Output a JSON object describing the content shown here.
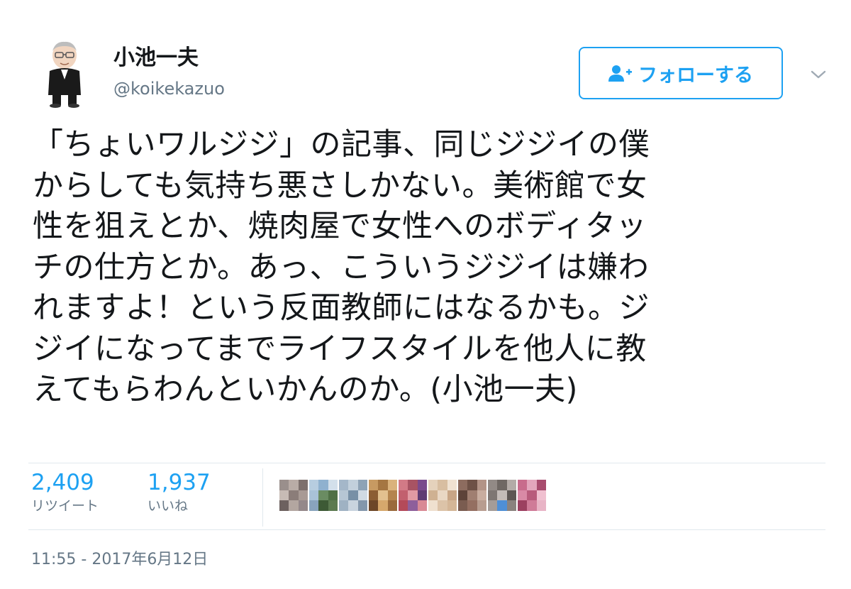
{
  "profile": {
    "display_name": "小池一夫",
    "username": "@koikekazuo"
  },
  "follow_button": {
    "label": "フォローする"
  },
  "tweet": {
    "lines": [
      "「ちょいワルジジ」の記事、同じジジイの僕",
      "からしても気持ち悪さしかない。美術館で女",
      "性を狙えとか、焼肉屋で女性へのボディタッ",
      "チの仕方とか。あっ、こういうジジイは嫌わ",
      "れますよ！という反面教師にはなるかも。ジ",
      "ジイになってまでライフスタイルを他人に教",
      "えてもらわんといかんのか。(小池一夫)"
    ]
  },
  "stats": {
    "retweets": {
      "count": "2,409",
      "label": "リツイート"
    },
    "likes": {
      "count": "1,937",
      "label": "いいね"
    }
  },
  "likers": [
    [
      "#9a8f8c",
      "#b9aca6",
      "#7d706d",
      "#c7bbb5",
      "#8b7d79",
      "#a89a95",
      "#6d615f",
      "#b3a6a0",
      "#94888a"
    ],
    [
      "#b7cde0",
      "#8fb1cf",
      "#d3e0eb",
      "#a9c2d8",
      "#6a8c62",
      "#4f7045",
      "#89a4bd",
      "#3d5a35",
      "#5c7a50"
    ],
    [
      "#a4b7c9",
      "#c2d0dc",
      "#8ea3b6",
      "#b6c6d4",
      "#7890a6",
      "#d0dae3",
      "#9fb2c3",
      "#c9d4de",
      "#8397ab"
    ],
    [
      "#c79a62",
      "#a57642",
      "#dab27c",
      "#8c5e34",
      "#e2c08f",
      "#b4844e",
      "#6d4728",
      "#d6a86c",
      "#9a6a3c"
    ],
    [
      "#d27a86",
      "#a85363",
      "#7a4a8c",
      "#c2606e",
      "#e09aa3",
      "#5f3c73",
      "#b44a5a",
      "#8e5f9b",
      "#d98a95"
    ],
    [
      "#e5d2bc",
      "#d8bea1",
      "#f0e2d2",
      "#cfb192",
      "#e9d7c4",
      "#c8a586",
      "#efe0cf",
      "#dcc3a8",
      "#d4b697"
    ],
    [
      "#8d6c5f",
      "#6e5146",
      "#b39487",
      "#5d4339",
      "#a07f71",
      "#c9ad9f",
      "#7a5c50",
      "#946f61",
      "#b89d90"
    ],
    [
      "#928a86",
      "#6f6864",
      "#b3aba7",
      "#7f7773",
      "#c4bcb8",
      "#5e5754",
      "#a49c98",
      "#4f8fd6",
      "#8a827e"
    ],
    [
      "#c86c8c",
      "#e3a6bc",
      "#a84c6e",
      "#d98aa6",
      "#b85c7c",
      "#f0c0d0",
      "#9c4060",
      "#cf7b98",
      "#e8b4c6"
    ]
  ],
  "timestamp": "11:55 - 2017年6月12日",
  "colors": {
    "accent": "#1da1f2",
    "text": "#14171a",
    "secondary": "#657786",
    "divider": "#e1e8ed"
  },
  "icons": {
    "follow": "follow-person-icon",
    "caret": "chevron-down-icon"
  }
}
